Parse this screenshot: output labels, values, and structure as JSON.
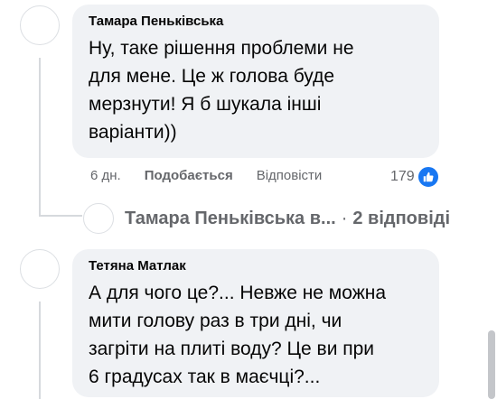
{
  "comments": [
    {
      "author": "Тамара Пеньківська",
      "text": "Ну, таке рішення проблеми не\nдля мене. Це ж голова буде\nмерзнути! Я б шукала інші\nваріанти))",
      "time": "6 дн.",
      "like_label": "Подобається",
      "reply_label": "Відповісти",
      "reaction_count": "179",
      "reaction_icon": "like-icon"
    },
    {
      "author": "Тетяна Матлак",
      "text": "А для чого це?... Невже не можна\nмити голову раз в три дні, чи\nзагріти на плиті воду? Це ви при\n6 градусах так в маєчці?..."
    }
  ],
  "replies_preview": {
    "name": "Тамара Пеньківська в...",
    "separator": "·",
    "count_label": "2 відповіді"
  },
  "colors": {
    "bubble": "#f0f2f5",
    "secondary_text": "#65676b",
    "like_blue": "#1877f2"
  }
}
